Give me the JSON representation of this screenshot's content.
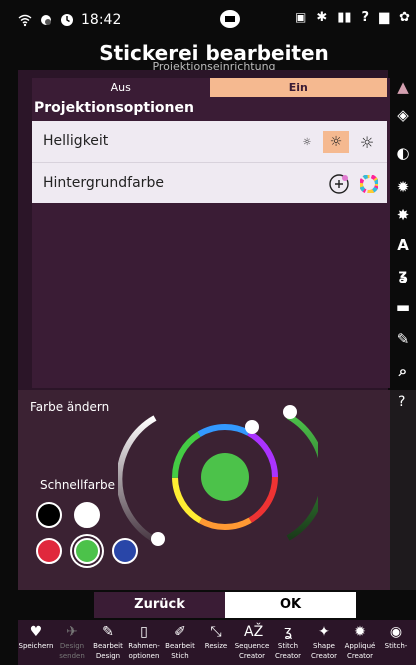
{
  "status": {
    "time": "18:42"
  },
  "header": {
    "title": "Stickerei bearbeiten",
    "subtitle": "Projektionseinrichtung"
  },
  "toggle": {
    "off_label": "Aus",
    "on_label": "Ein",
    "selected": "Ein"
  },
  "section": {
    "title": "Projektionsoptionen"
  },
  "options": {
    "brightness_label": "Helligkeit",
    "background_label": "Hintergrundfarbe",
    "brightness_levels": [
      "low",
      "medium",
      "high"
    ],
    "brightness_selected": "medium"
  },
  "color": {
    "change_label": "Farbe ändern",
    "quick_label": "Schnellfarbe",
    "selected_color": "#4cc24a",
    "swatches": [
      "#000000",
      "#ffffff",
      "#e0283c",
      "#4cc24a",
      "#2946a8"
    ]
  },
  "buttons": {
    "back": "Zurück",
    "ok": "OK"
  },
  "toolbar": [
    {
      "line1": "Speichern",
      "line2": "",
      "icon": "heart-icon",
      "enabled": true
    },
    {
      "line1": "Design",
      "line2": "senden",
      "icon": "send-icon",
      "enabled": false
    },
    {
      "line1": "Bearbeit",
      "line2": "Design",
      "icon": "edit-design-icon",
      "enabled": true
    },
    {
      "line1": "Rahmen-",
      "line2": "optionen",
      "icon": "frame-icon",
      "enabled": true
    },
    {
      "line1": "Bearbeit",
      "line2": "Stich",
      "icon": "edit-stitch-icon",
      "enabled": true
    },
    {
      "line1": "Resize",
      "line2": "",
      "icon": "resize-icon",
      "enabled": true
    },
    {
      "line1": "Sequence",
      "line2": "Creator",
      "icon": "sequence-icon",
      "enabled": true
    },
    {
      "line1": "Stitch",
      "line2": "Creator",
      "icon": "stitch-creator-icon",
      "enabled": true
    },
    {
      "line1": "Shape",
      "line2": "Creator",
      "icon": "shape-creator-icon",
      "enabled": true
    },
    {
      "line1": "Appliqué",
      "line2": "Creator",
      "icon": "applique-icon",
      "enabled": true
    },
    {
      "line1": "Stitch-",
      "line2": "",
      "icon": "stitch-icon",
      "enabled": true
    }
  ]
}
